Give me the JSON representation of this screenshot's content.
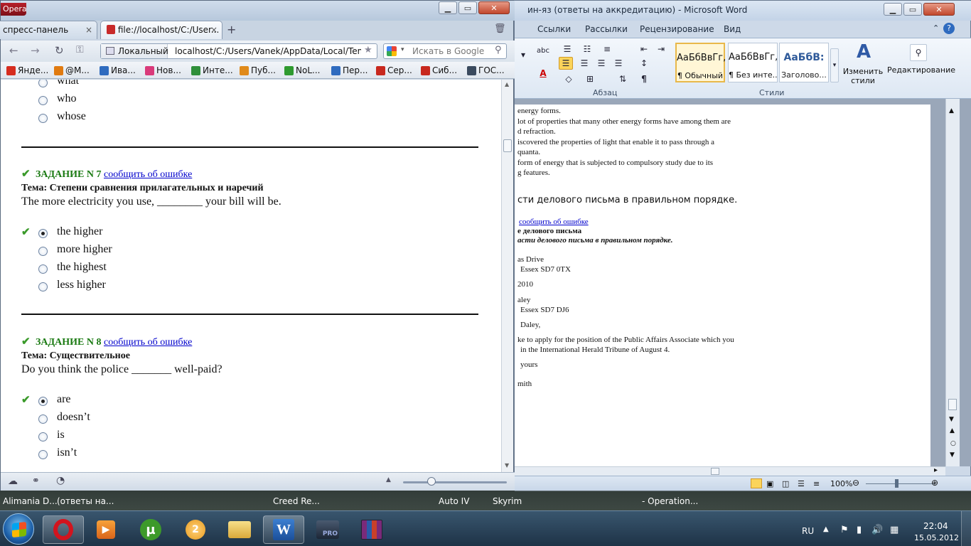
{
  "word": {
    "title": "ин-яз (ответы на аккредитацию)  -  Microsoft Word",
    "tabs": [
      "Ссылки",
      "Рассылки",
      "Рецензирование",
      "Вид"
    ],
    "groups": {
      "paragraph": "Абзац",
      "styles": "Стили"
    },
    "styles": [
      {
        "sample": "АаБбВвГг,",
        "name": "¶ Обычный"
      },
      {
        "sample": "АаБбВвГг,",
        "name": "¶ Без инте..."
      },
      {
        "sample": "АаБбВ:",
        "name": "Заголово..."
      }
    ],
    "change_styles": "Изменить стили",
    "editing": "Редактирование",
    "doc_lines": [
      "energy forms.",
      "lot of properties that many other energy forms have among them are",
      "d refraction.",
      "iscovered the properties of light that enable it to pass through a",
      "quanta.",
      "form of energy that is subjected to compulsory study due to its",
      "g features."
    ],
    "doc_heading": "сти делового письма в правильном порядке.",
    "doc_link": "сообщить об ошибке",
    "doc_topic": "е делового письма",
    "doc_task": "асти делового письма в правильном порядке.",
    "doc_letter": [
      "as Drive",
      "Essex SD7 0TX",
      "2010",
      "aley",
      "Essex SD7 DJ6",
      "Daley,",
      "ke to apply for the position of the Public Affairs Associate which you",
      "in the International Herald Tribune of August 4.",
      "yours",
      "mith"
    ],
    "zoom": "100%"
  },
  "opera": {
    "app_label": "Opera",
    "tabs": [
      "спресс-панель",
      "file://localhost/C:/User..."
    ],
    "address_label": "Локальный",
    "url": "localhost/C:/Users/Vanek/AppData/Local/Temp/F",
    "search_placeholder": "Искать в Google",
    "bookmarks": [
      "Янде...",
      "@M...",
      "Ива...",
      "Нов...",
      "Инте...",
      "Пуб...",
      "NoL...",
      "Пер...",
      "Сер...",
      "Сиб...",
      "ГОС..."
    ],
    "bookmark_colors": [
      "#d62c1f",
      "#e07a10",
      "#2f6bbf",
      "#d93a7a",
      "#2f8f3a",
      "#e08a1a",
      "#2f9a2f",
      "#2f6bbf",
      "#c8281e",
      "#c8281e",
      "#3a4a5e"
    ],
    "report_link": "сообщить об ошибке",
    "prev_options": [
      "what",
      "who",
      "whose"
    ],
    "tasks": [
      {
        "label": "ЗАДАНИЕ N 7",
        "topic": "Тема: Степени сравнения прилагательных и наречий",
        "question": "The more electricity you use, ________ your bill will be.",
        "options": [
          "the higher",
          "more higher",
          "the highest",
          "less higher"
        ],
        "selected": 0
      },
      {
        "label": "ЗАДАНИЕ N 8",
        "topic": "Тема: Существительное",
        "question": "Do you think the police _______ well-paid?",
        "options": [
          "are",
          "doesn’t",
          "is",
          "isn’t"
        ],
        "selected": 0
      }
    ]
  },
  "taskbar_strip": [
    "Alimania D...",
    "(ответы на...",
    "Creed Re...",
    "Auto IV",
    "Skyrim",
    "- Operation..."
  ],
  "tray": {
    "lang": "RU",
    "time": "22:04",
    "date": "15.05.2012"
  }
}
